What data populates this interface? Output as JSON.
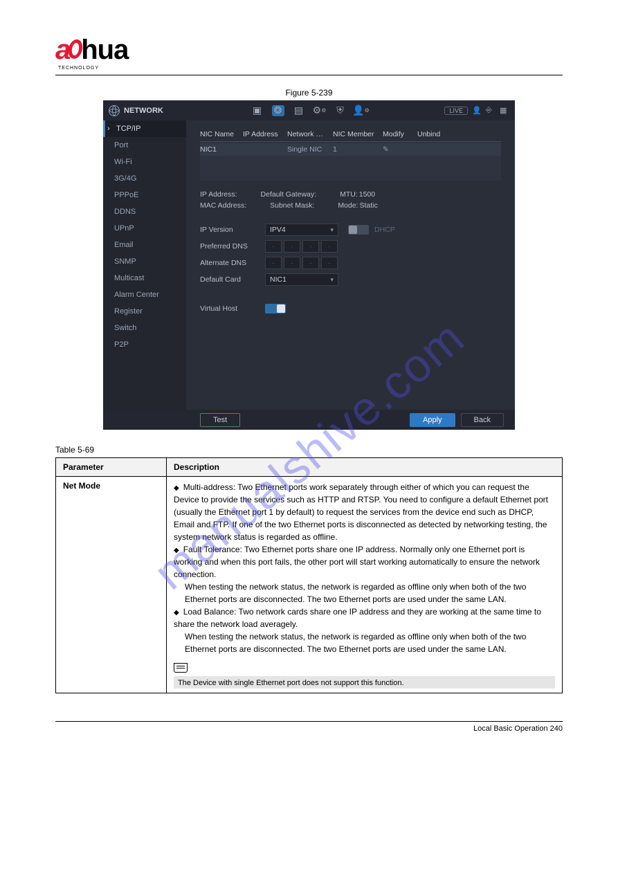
{
  "logo": {
    "text_a": "a",
    "text_rest": "hua",
    "sub": "TECHNOLOGY"
  },
  "figure_caption": "Figure 5-239",
  "titlebar": {
    "title": "NETWORK",
    "live": "LIVE"
  },
  "top_icons": {
    "cam": "camera-icon",
    "globe": "globe-icon",
    "storage": "storage-icon",
    "gear": "settings-icon",
    "shield": "shield-icon",
    "user": "user-group-icon"
  },
  "titlebar_right_icons": {
    "user": "user-icon",
    "enter": "enter-icon",
    "grid": "grid-icon"
  },
  "sidebar": {
    "items": [
      {
        "label": "TCP/IP",
        "active": true
      },
      {
        "label": "Port"
      },
      {
        "label": "Wi-Fi"
      },
      {
        "label": "3G/4G"
      },
      {
        "label": "PPPoE"
      },
      {
        "label": "DDNS"
      },
      {
        "label": "UPnP"
      },
      {
        "label": "Email"
      },
      {
        "label": "SNMP"
      },
      {
        "label": "Multicast"
      },
      {
        "label": "Alarm Center"
      },
      {
        "label": "Register"
      },
      {
        "label": "Switch"
      },
      {
        "label": "P2P"
      }
    ]
  },
  "table": {
    "cols": [
      "NIC Name",
      "IP Address",
      "Network …",
      "NIC Member",
      "Modify",
      "Unbind"
    ],
    "row": {
      "nic": "NIC1",
      "ip": "",
      "net": "Single NIC",
      "mem": "1",
      "mod": "✎",
      "un": ""
    }
  },
  "info": {
    "ip_label": "IP Address:",
    "ip_val": "",
    "gw_label": "Default Gateway:",
    "gw_val": "",
    "mtu_label": "MTU:",
    "mtu_val": "1500",
    "mac_label": "MAC Address:",
    "mac_val": "",
    "mask_label": "Subnet Mask:",
    "mask_val": "",
    "mode_label": "Mode:",
    "mode_val": "Static"
  },
  "form": {
    "ipver_label": "IP Version",
    "ipver_val": "IPV4",
    "dhcp": "DHCP",
    "pref_label": "Preferred DNS",
    "alt_label": "Alternate DNS",
    "card_label": "Default Card",
    "card_val": "NIC1",
    "vhost_label": "Virtual Host"
  },
  "buttons": {
    "test": "Test",
    "apply": "Apply",
    "back": "Back"
  },
  "table_caption": "Table 5-69",
  "desc": {
    "hdr_param": "Parameter",
    "hdr_desc": "Description",
    "param": "Net Mode",
    "lines": [
      "Multi-address: Two Ethernet ports work separately through either of which you can request the Device to provide the services such as HTTP and RTSP. You need to configure a default Ethernet port (usually the Ethernet port 1 by default) to request the services from the device end such as DHCP, Email and FTP. If one of the two Ethernet ports is disconnected as detected by networking testing, the system network status is regarded as offline.",
      "Fault Tolerance: Two Ethernet ports share one IP address. Normally only one Ethernet port is working and when this port fails, the other port will start working automatically to ensure the network connection.",
      "When testing the network status, the network is regarded as offline only when both of the two Ethernet ports are disconnected. The two Ethernet ports are used under the same LAN.",
      "Load Balance: Two network cards share one IP address and they are working at the same time to share the network load averagely.",
      "When testing the network status, the network is regarded as offline only when both of the two Ethernet ports are disconnected. The two Ethernet ports are used under the same LAN."
    ],
    "note": "The Device with single Ethernet port does not support this function."
  },
  "watermark": "manualshive.com",
  "footer": {
    "left": "",
    "right": "Local Basic Operation 240"
  },
  "chart_data": null
}
